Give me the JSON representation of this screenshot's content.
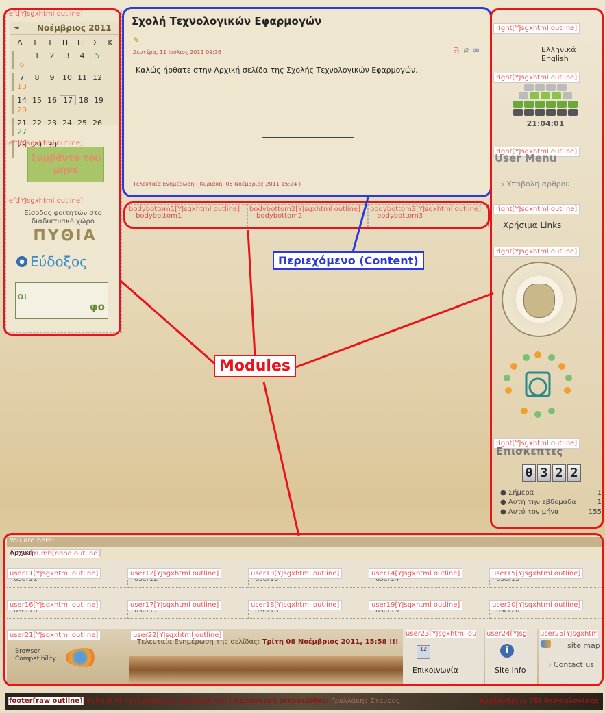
{
  "content": {
    "title": "Σχολή Τεχνολογικών Εφαρμογών",
    "date": "Δευτέρα, 11 Ιούλιος 2011 09:36",
    "body": "Καλώς ήρθατε στην Αρχική σελίδα της Σχολής Τεχνολογικών Εφαρμογών..",
    "updated": "Τελευταία Ενημέρωση ( Κυριακή, 06 Νοέμβριος 2011 15:24 )"
  },
  "labels": {
    "left_outline": "left[YJsgxhtml outline]",
    "right_outline": "right[YJsgxhtml outline]",
    "bodybottom1_outline": "bodybottom1[YJsgxhtml outline]",
    "bodybottom2_outline": "bodybottom2[YJsgxhtml outline]",
    "bodybottom3_outline": "bodybottom3[YJsgxhtml outline]",
    "bodybottom1": "bodybottom1",
    "bodybottom2": "bodybottom2",
    "bodybottom3": "bodybottom3",
    "breadcrumb_outline": "breadcrumb[none outline]",
    "footer_outline": "footer[raw outline]"
  },
  "calendar": {
    "month": "Νοέμβριος 2011",
    "prev": "◄",
    "weekdays": [
      "Δ",
      "Τ",
      "Τ",
      "Π",
      "Π",
      "Σ",
      "Κ"
    ],
    "weeks": [
      [
        "",
        "1",
        "2",
        "3",
        "4",
        "5",
        "6"
      ],
      [
        "7",
        "8",
        "9",
        "10",
        "11",
        "12",
        "13"
      ],
      [
        "14",
        "15",
        "16",
        "17",
        "18",
        "19",
        "20"
      ],
      [
        "21",
        "22",
        "23",
        "24",
        "25",
        "26",
        "27"
      ],
      [
        "28",
        "29",
        "30",
        "",
        "",
        "",
        ""
      ]
    ]
  },
  "left": {
    "events_button": "Συμβάντα του μήνα",
    "students_entry": "Είσοδος φοιτητών στο διαδικτυακό χώρο",
    "pythia": "ΠΥΘΙΑ",
    "eudoxos": "Εύδοξος",
    "banner_left": "αι",
    "banner_right": "φο"
  },
  "right": {
    "languages": "Ελληνικά English",
    "clock": "21:04:01",
    "user_menu_title": "User Menu",
    "submit_article": "Υποβολη αρθρου",
    "useful_links": "Χρήσιμα Links",
    "visitors_title": "Επισκεπτες",
    "counter_digits": [
      "0",
      "3",
      "2",
      "2"
    ],
    "stats": [
      {
        "label": "Σήμερα",
        "value": "1"
      },
      {
        "label": "Αυτή την εβδομάδα",
        "value": "1"
      },
      {
        "label": "Αυτό τον μήνα",
        "value": "155"
      }
    ]
  },
  "annotations": {
    "content": "Περιεχόμενο (Content)",
    "modules": "Modules"
  },
  "bottom": {
    "you_are_here": "You are here:",
    "home": "Αρχική",
    "user_row1": [
      {
        "outline": "user11[YJsgxhtml outline]",
        "name": "user11"
      },
      {
        "outline": "user12[YJsgxhtml outline]",
        "name": "user12"
      },
      {
        "outline": "user13[YJsgxhtml outline]",
        "name": "user13"
      },
      {
        "outline": "user14[YJsgxhtml outline]",
        "name": "user14"
      },
      {
        "outline": "user15[YJsgxhtml outline]",
        "name": "user15"
      }
    ],
    "user_row2": [
      {
        "outline": "user16[YJsgxhtml outline]",
        "name": "user16"
      },
      {
        "outline": "user17[YJsgxhtml outline]",
        "name": "user17"
      },
      {
        "outline": "user18[YJsgxhtml outline]",
        "name": "user18"
      },
      {
        "outline": "user19[YJsgxhtml outline]",
        "name": "user19"
      },
      {
        "outline": "user20[YJsgxhtml outline]",
        "name": "user20"
      }
    ],
    "user21": "user21[YJsgxhtml outline]",
    "user22": "user22[YJsgxhtml outline]",
    "user23": "user23[YJsgxhtml ou",
    "user24": "user24[YJsg",
    "user25": "user25[YJsgxhtm",
    "browser_compat": "Browser Compatibility",
    "last_update_label": "Τελευταία Ενημέρωση της σελίδας:",
    "last_update_value": "Τρίτη 08 Νοέμβριος 2011, 15:58 !!!",
    "contact": "Επικοινωνία",
    "site_info": "Site Info",
    "site_map": "site map",
    "contact_us": "Contact us"
  },
  "footer": {
    "text_left": "School of Technological Applications | Κατασκευή ιστοσελίδας:",
    "author": "Γρυλλάκης Σταυρος",
    "text_right": "Αλεξάνδρειο ΤΕΙ Θεσσαλονίκης"
  }
}
